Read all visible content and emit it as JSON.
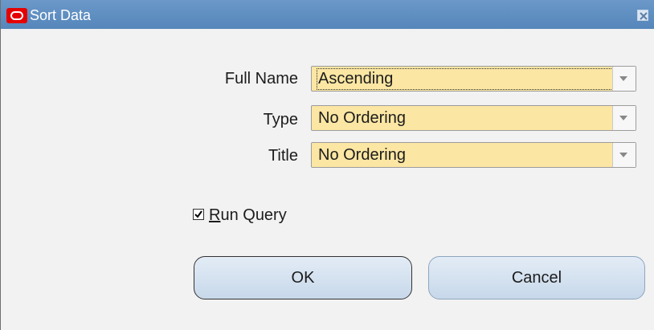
{
  "window": {
    "title": "Sort Data",
    "close_label": "×"
  },
  "fields": [
    {
      "label": "Full Name",
      "value": "Ascending"
    },
    {
      "label": "Type",
      "value": "No Ordering"
    },
    {
      "label": "Title",
      "value": "No Ordering"
    }
  ],
  "run_query": {
    "label": "Run Query",
    "checked": true
  },
  "buttons": {
    "ok_label": "OK",
    "cancel_label": "Cancel"
  },
  "colors": {
    "title_bar": "#5f8fc2",
    "field_bg": "#fbe6a3",
    "button_bg": "#d7e3f0",
    "logo_red": "#e60000"
  },
  "icons": {
    "logo": "oracle-logo-icon",
    "close": "close-icon",
    "dropdown": "chevron-down-icon",
    "check": "checkmark-icon"
  }
}
